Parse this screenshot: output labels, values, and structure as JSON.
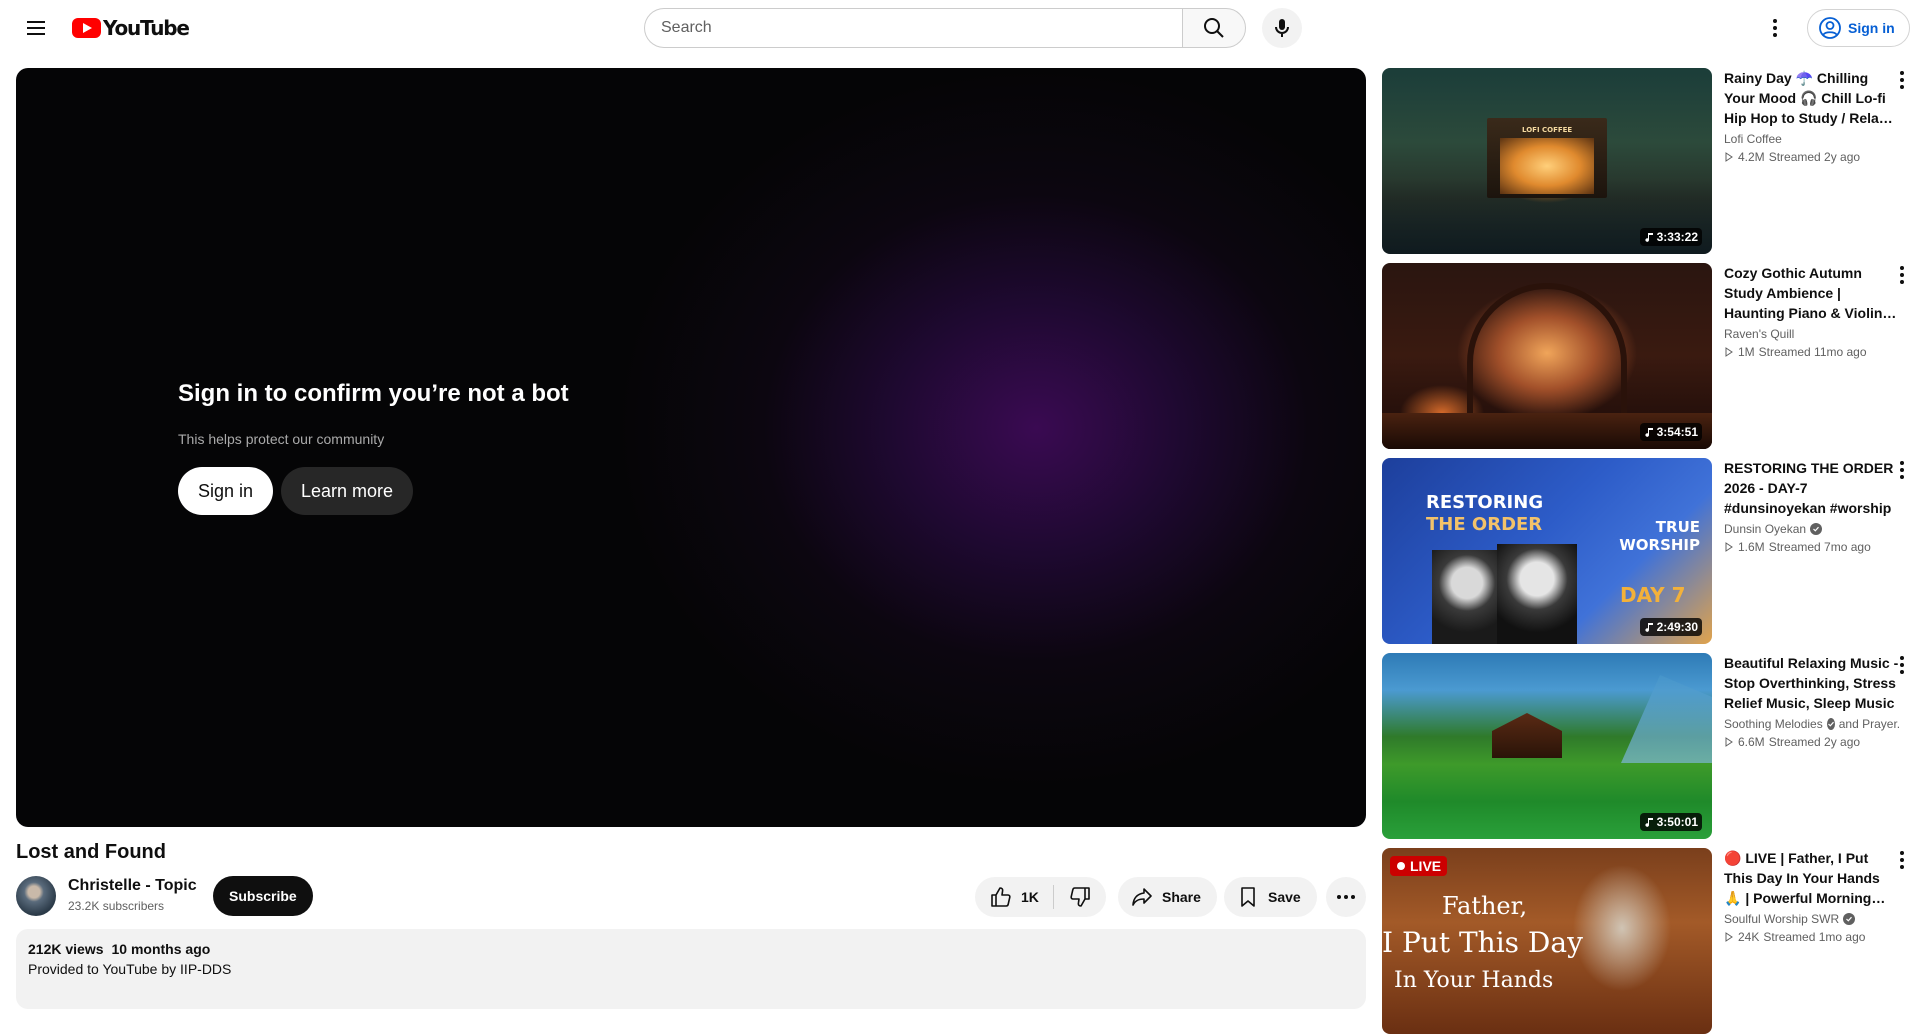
{
  "header": {
    "logo_text": "YouTube",
    "search_placeholder": "Search",
    "sign_in_label": "Sign in"
  },
  "player": {
    "overlay_title": "Sign in to confirm you’re not a bot",
    "overlay_subtitle": "This helps protect our community",
    "sign_in_label": "Sign in",
    "learn_more_label": "Learn more"
  },
  "video": {
    "title": "Lost and Found",
    "channel_name": "Christelle - Topic",
    "subscribers": "23.2K subscribers",
    "subscribe_label": "Subscribe",
    "likes": "1K",
    "share_label": "Share",
    "save_label": "Save",
    "views": "212K views",
    "uploaded": "10 months ago",
    "description": "Provided to YouTube by IIP-DDS"
  },
  "recommendations": [
    {
      "title": "Rainy Day ☂️ Chilling Your Mood 🎧 Chill Lo-fi Hip Hop to Study / Relax / Work",
      "channel": "Lofi Coffee",
      "verified": false,
      "views": "4.2M",
      "age": "Streamed 2y ago",
      "duration": "3:33:22",
      "thumb_text": "LOFI COFFEE"
    },
    {
      "title": "Cozy Gothic Autumn Study Ambience | Haunting Piano & Violin Music",
      "channel": "Raven's Quill",
      "verified": false,
      "views": "1M",
      "age": "Streamed 11mo ago",
      "duration": "3:54:51"
    },
    {
      "title": "RESTORING THE ORDER 2026 - DAY-7 #dunsinoyekan #worship",
      "channel": "Dunsin Oyekan",
      "verified": true,
      "views": "1.6M",
      "age": "Streamed 7mo ago",
      "duration": "2:49:30",
      "thumb_line1": "RESTORING",
      "thumb_line2": "THE ORDER",
      "thumb_line3": "TRUE WORSHIP",
      "thumb_day": "DAY 7"
    },
    {
      "title": "Beautiful Relaxing Music - Stop Overthinking, Stress Relief Music, Sleep Music",
      "channel": "Soothing Melodies",
      "channel_extra": "and Prayer...",
      "verified": true,
      "views": "6.6M",
      "age": "Streamed 2y ago",
      "duration": "3:50:01"
    },
    {
      "title": "🔴 LIVE | Father, I Put This Day In Your Hands 🙏 | Powerful Morning Prayer",
      "channel": "Soulful Worship SWR",
      "verified": true,
      "views": "24K",
      "age": "Streamed 1mo ago",
      "live_label": "LIVE",
      "thumb_line1": "Father,",
      "thumb_line2": "I Put This Day",
      "thumb_line3": "In Your Hands"
    }
  ]
}
